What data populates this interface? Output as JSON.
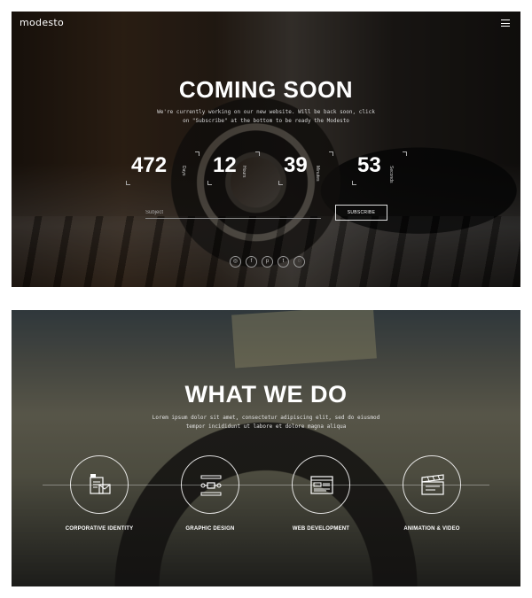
{
  "header": {
    "logo": "modesto",
    "menu_icon": "hamburger-menu-icon"
  },
  "hero": {
    "title": "COMING SOON",
    "subtitle": "We're currently working on our new website. Will be back soon, click on \"Subscribe\" at the bottom to be ready the Modesto",
    "countdown": [
      {
        "value": "472",
        "label": "Days"
      },
      {
        "value": "12",
        "label": "Hours"
      },
      {
        "value": "39",
        "label": "Minutes"
      },
      {
        "value": "53",
        "label": "Seconds"
      }
    ],
    "subscribe": {
      "placeholder": "Subject",
      "button_label": "SUBSCRIBE"
    },
    "social_icons": [
      {
        "name": "instagram-icon",
        "glyph": "◎"
      },
      {
        "name": "facebook-icon",
        "glyph": "f"
      },
      {
        "name": "pinterest-icon",
        "glyph": "p"
      },
      {
        "name": "twitter-icon",
        "glyph": "t"
      },
      {
        "name": "dribbble-icon",
        "glyph": "◌"
      }
    ]
  },
  "services": {
    "title": "WHAT WE DO",
    "subtitle": "Lorem ipsum dolor sit amet, consectetur adipiscing elit, sed do eiusmod tempor incididunt ut labore et dolore magna aliqua",
    "items": [
      {
        "label": "CORPORATIVE IDENTITY",
        "icon": "corporate-identity-icon"
      },
      {
        "label": "GRAPHIC DESIGN",
        "icon": "graphic-design-icon"
      },
      {
        "label": "WEB DEVELOPMENT",
        "icon": "web-development-icon"
      },
      {
        "label": "ANIMATION & VIDEO",
        "icon": "animation-video-icon"
      }
    ]
  }
}
